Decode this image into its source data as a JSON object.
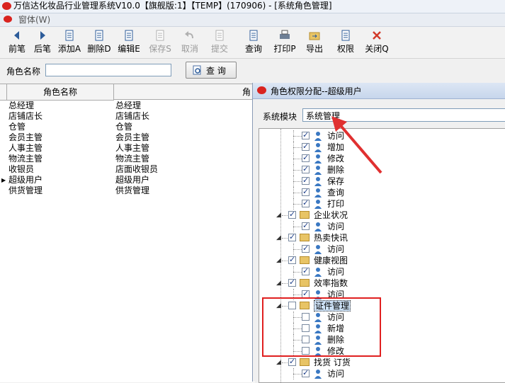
{
  "window": {
    "title": "万信达化妆品行业管理系统V10.0【旗舰版:1】【TEMP】(170906) - [系统角色管理]"
  },
  "menubar": {
    "item": "窗体(W)"
  },
  "toolbar": {
    "buttons": [
      {
        "label": "前笔",
        "icon": "arrow-left-icon",
        "enabled": true
      },
      {
        "label": "后笔",
        "icon": "arrow-right-icon",
        "enabled": true
      },
      {
        "label": "添加",
        "icon": "add-doc-icon",
        "enabled": true
      },
      {
        "label": "删除",
        "icon": "delete-doc-icon",
        "enabled": true
      },
      {
        "label": "编辑",
        "icon": "edit-doc-icon",
        "enabled": true
      },
      {
        "label": "保存",
        "icon": "save-icon",
        "enabled": false
      },
      {
        "label": "取消",
        "icon": "undo-icon",
        "enabled": false
      },
      {
        "label": "提交",
        "icon": "submit-icon",
        "enabled": false
      },
      {
        "label": "查询",
        "icon": "query-icon",
        "enabled": true
      },
      {
        "label": "打印",
        "icon": "printer-icon",
        "enabled": true
      },
      {
        "label": "导出",
        "icon": "export-icon",
        "enabled": true
      },
      {
        "label": "权限",
        "icon": "permission-icon",
        "enabled": true
      },
      {
        "label": "关闭",
        "icon": "close-icon",
        "enabled": true
      }
    ],
    "shortcuts": [
      "",
      "",
      "A",
      "D",
      "E",
      "S",
      "",
      "",
      "",
      "P",
      "",
      "",
      "Q"
    ]
  },
  "search": {
    "label": "角色名称",
    "value": "",
    "button": "查 询"
  },
  "grid": {
    "columns": [
      "角色名称",
      "角"
    ],
    "rows": [
      [
        "总经理",
        "总经理"
      ],
      [
        "店铺店长",
        "店铺店长"
      ],
      [
        "仓管",
        "仓管"
      ],
      [
        "会员主管",
        "会员主管"
      ],
      [
        "人事主管",
        "人事主管"
      ],
      [
        "物流主管",
        "物流主管"
      ],
      [
        "收银员",
        "店面收银员"
      ],
      [
        "超级用户",
        "超级用户"
      ],
      [
        "供货管理",
        "供货管理"
      ]
    ],
    "current_row": 7
  },
  "dialog": {
    "title": "角色权限分配--超级用户",
    "module_label": "系统模块",
    "module_value": "系统管理",
    "tree": [
      {
        "level": 2,
        "label": "访问",
        "checked": true,
        "type": "user"
      },
      {
        "level": 2,
        "label": "增加",
        "checked": true,
        "type": "user"
      },
      {
        "level": 2,
        "label": "修改",
        "checked": true,
        "type": "user"
      },
      {
        "level": 2,
        "label": "删除",
        "checked": true,
        "type": "user"
      },
      {
        "level": 2,
        "label": "保存",
        "checked": true,
        "type": "user"
      },
      {
        "level": 2,
        "label": "查询",
        "checked": true,
        "type": "user"
      },
      {
        "level": 2,
        "label": "打印",
        "checked": true,
        "type": "user"
      },
      {
        "level": 1,
        "label": "企业状况",
        "checked": true,
        "type": "folder"
      },
      {
        "level": 2,
        "label": "访问",
        "checked": true,
        "type": "user"
      },
      {
        "level": 1,
        "label": "热卖快讯",
        "checked": true,
        "type": "folder"
      },
      {
        "level": 2,
        "label": "访问",
        "checked": true,
        "type": "user"
      },
      {
        "level": 1,
        "label": "健康视图",
        "checked": true,
        "type": "folder"
      },
      {
        "level": 2,
        "label": "访问",
        "checked": true,
        "type": "user"
      },
      {
        "level": 1,
        "label": "效率指数",
        "checked": true,
        "type": "folder"
      },
      {
        "level": 2,
        "label": "访问",
        "checked": true,
        "type": "user"
      },
      {
        "level": 1,
        "label": "证件管理",
        "checked": false,
        "type": "folder",
        "selected": true
      },
      {
        "level": 2,
        "label": "访问",
        "checked": false,
        "type": "user"
      },
      {
        "level": 2,
        "label": "新增",
        "checked": false,
        "type": "user"
      },
      {
        "level": 2,
        "label": "删除",
        "checked": false,
        "type": "user"
      },
      {
        "level": 2,
        "label": "修改",
        "checked": false,
        "type": "user"
      },
      {
        "level": 1,
        "label": "找货 订货",
        "checked": true,
        "type": "folder"
      },
      {
        "level": 2,
        "label": "访问",
        "checked": true,
        "type": "user"
      }
    ]
  },
  "colors": {
    "highlight_box": "#e02020",
    "arrow": "#e03030",
    "selection": "#cce0f5"
  }
}
